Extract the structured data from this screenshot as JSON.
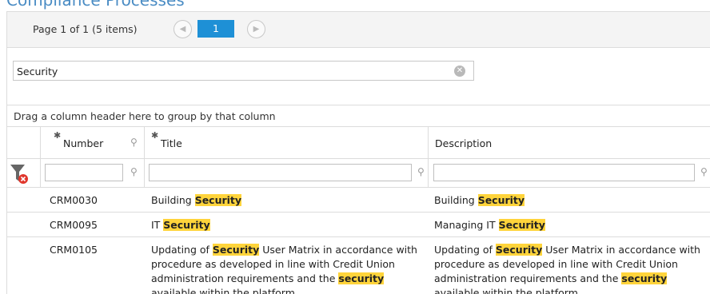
{
  "page": {
    "title": "Compliance Processes"
  },
  "pager": {
    "summary": "Page 1 of 1 (5 items)",
    "prev_icon": "◀",
    "current_page": "1",
    "next_icon": "▶"
  },
  "search": {
    "value": "Security",
    "clear_icon": "✕"
  },
  "group_panel": {
    "text": "Drag a column header here to group by that column"
  },
  "columns": {
    "number": "Number",
    "title": "Title",
    "description": "Description"
  },
  "highlight_color": "#ffd43b",
  "rows": [
    {
      "number": "CRM0030",
      "title": {
        "pre": "Building ",
        "hl": "Security",
        "mid": "",
        "hl2": "",
        "post": ""
      },
      "description": {
        "pre": "Building ",
        "hl": "Security",
        "mid": "",
        "hl2": "",
        "post": ""
      }
    },
    {
      "number": "CRM0095",
      "title": {
        "pre": "IT ",
        "hl": "Security",
        "mid": "",
        "hl2": "",
        "post": ""
      },
      "description": {
        "pre": "Managing IT ",
        "hl": "Security",
        "mid": "",
        "hl2": "",
        "post": ""
      }
    },
    {
      "number": "CRM0105",
      "title": {
        "pre": "Updating of ",
        "hl": "Security",
        "mid": " User Matrix in accordance with procedure as developed in line with Credit Union administration requirements and the ",
        "hl2": "security",
        "post": " available within the platform."
      },
      "description": {
        "pre": "Updating of ",
        "hl": "Security",
        "mid": " User Matrix in accordance with procedure as developed in line with Credit Union administration requirements and the ",
        "hl2": "security",
        "post": " available within the platform."
      }
    }
  ]
}
